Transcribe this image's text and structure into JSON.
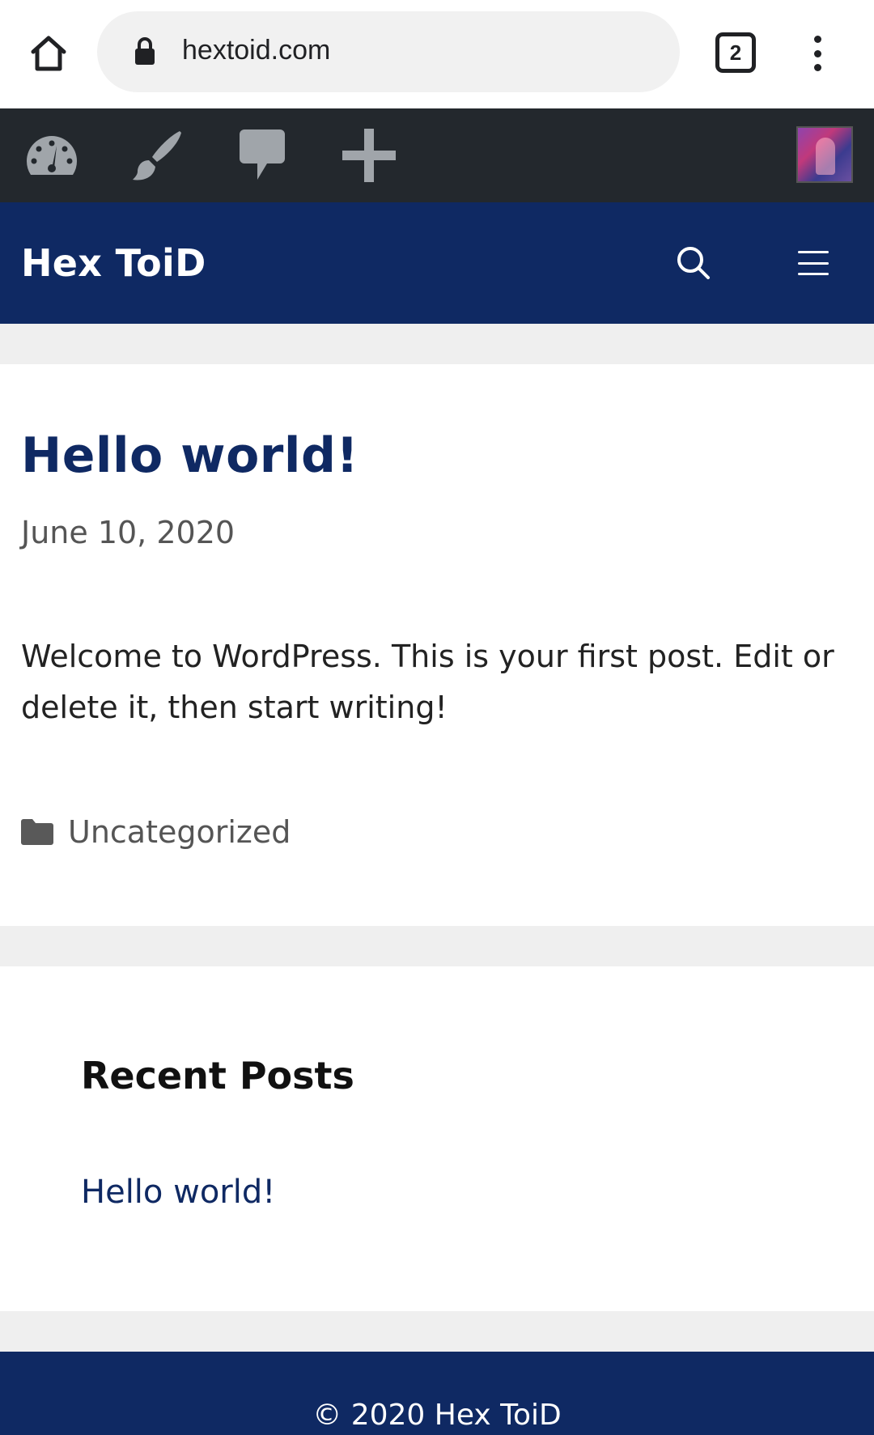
{
  "browser": {
    "url": "hextoid.com",
    "tab_count": "2"
  },
  "admin_bar": {
    "items": [
      "dashboard-icon",
      "customize-brush-icon",
      "comments-icon",
      "new-content-plus-icon"
    ],
    "avatar": "user-avatar"
  },
  "site": {
    "title": "Hex ToiD"
  },
  "post": {
    "title": "Hello world!",
    "date": "June 10, 2020",
    "content": "Welcome to WordPress. This is your first post. Edit or delete it, then start writing!",
    "category": "Uncategorized"
  },
  "widget": {
    "title": "Recent Posts",
    "items": [
      "Hello world!"
    ]
  },
  "footer": {
    "text": "© 2020 Hex ToiD"
  },
  "colors": {
    "brand_navy": "#0f2963",
    "admin_bar": "#23282d",
    "page_bg": "#efefef"
  }
}
